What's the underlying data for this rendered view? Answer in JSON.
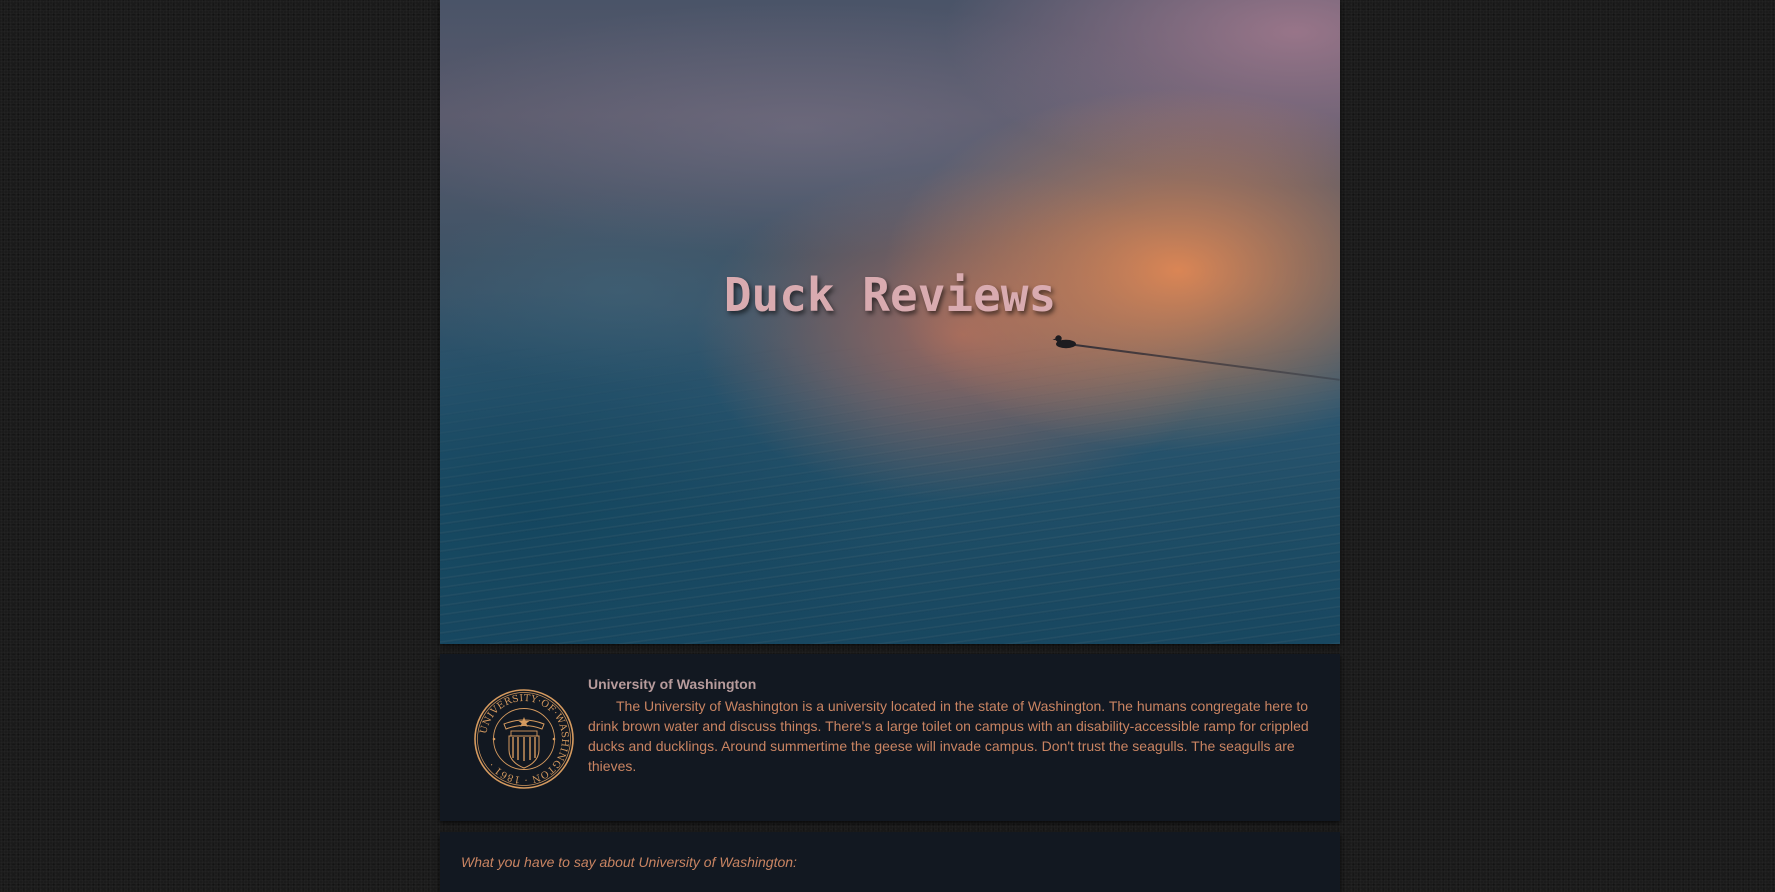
{
  "site": {
    "title": "Duck Reviews"
  },
  "hero": {
    "image": "duck-on-misty-lake-sunrise",
    "icon": "duck-icon"
  },
  "location": {
    "seal_icon": "university-of-washington-seal-icon",
    "seal_text": "UNIVERSITY·OF·WASHINGTON · 1861 ·",
    "name": "University of Washington",
    "description": "The University of Washington is a university located in the state of Washington. The humans congregate here to drink brown water and discuss things. There's a large toilet on campus with an disability-accessible ramp for crippled ducks and ducklings. Around summertime the geese will invade campus. Don't trust the seagulls. The seagulls are thieves."
  },
  "comments": {
    "prompt": "What you have to say about University of Washington:"
  },
  "colors": {
    "page_background": "#1b1b1b",
    "card_background": "#121821",
    "accent_text": "#c98462",
    "heading_text": "#b79b9c",
    "title_text": "#d9abb0",
    "seal_gold": "#d59a5f"
  }
}
